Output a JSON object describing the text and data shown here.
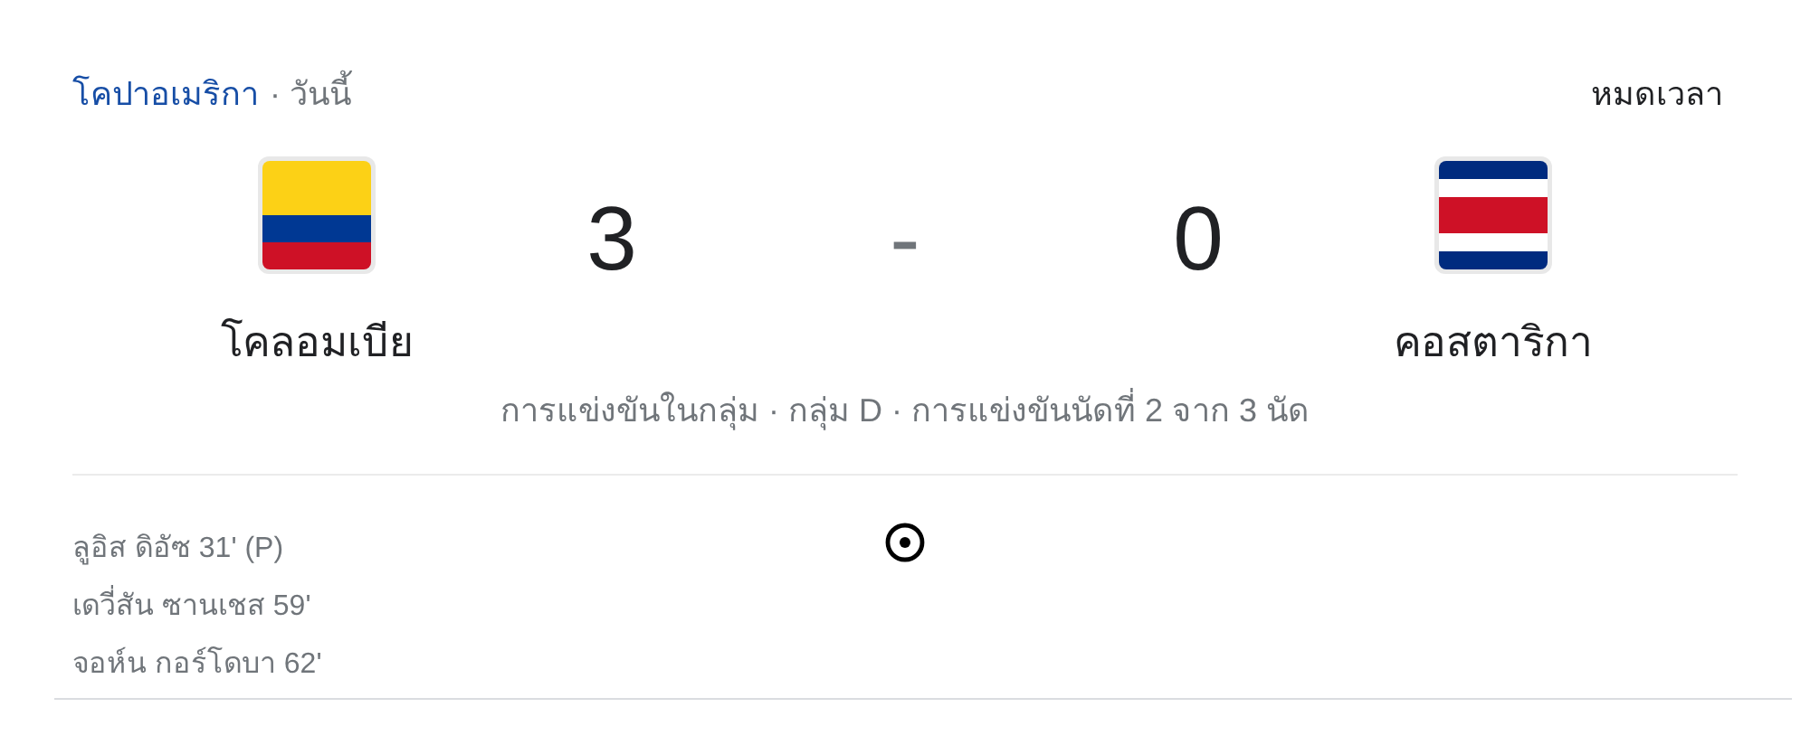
{
  "header": {
    "competition": "โคปาอเมริกา",
    "date": "· วันนี้",
    "status": "หมดเวลา"
  },
  "home": {
    "name": "โคลอมเบีย",
    "kind": "tricolor",
    "score": "3"
  },
  "separator": "-",
  "away": {
    "name": "คอสตาริกา",
    "kind": "five_stripe",
    "score": "0"
  },
  "match_info": "การแข่งขันในกลุ่ม · กลุ่ม D · การแข่งขันนัดที่ 2 จาก 3 นัด",
  "home_scorers": [
    "ลูอิส ดิอัซ 31' (P)",
    "เดวี่สัน ซานเชส 59'",
    "จอห์น กอร์โดบา 62'"
  ]
}
